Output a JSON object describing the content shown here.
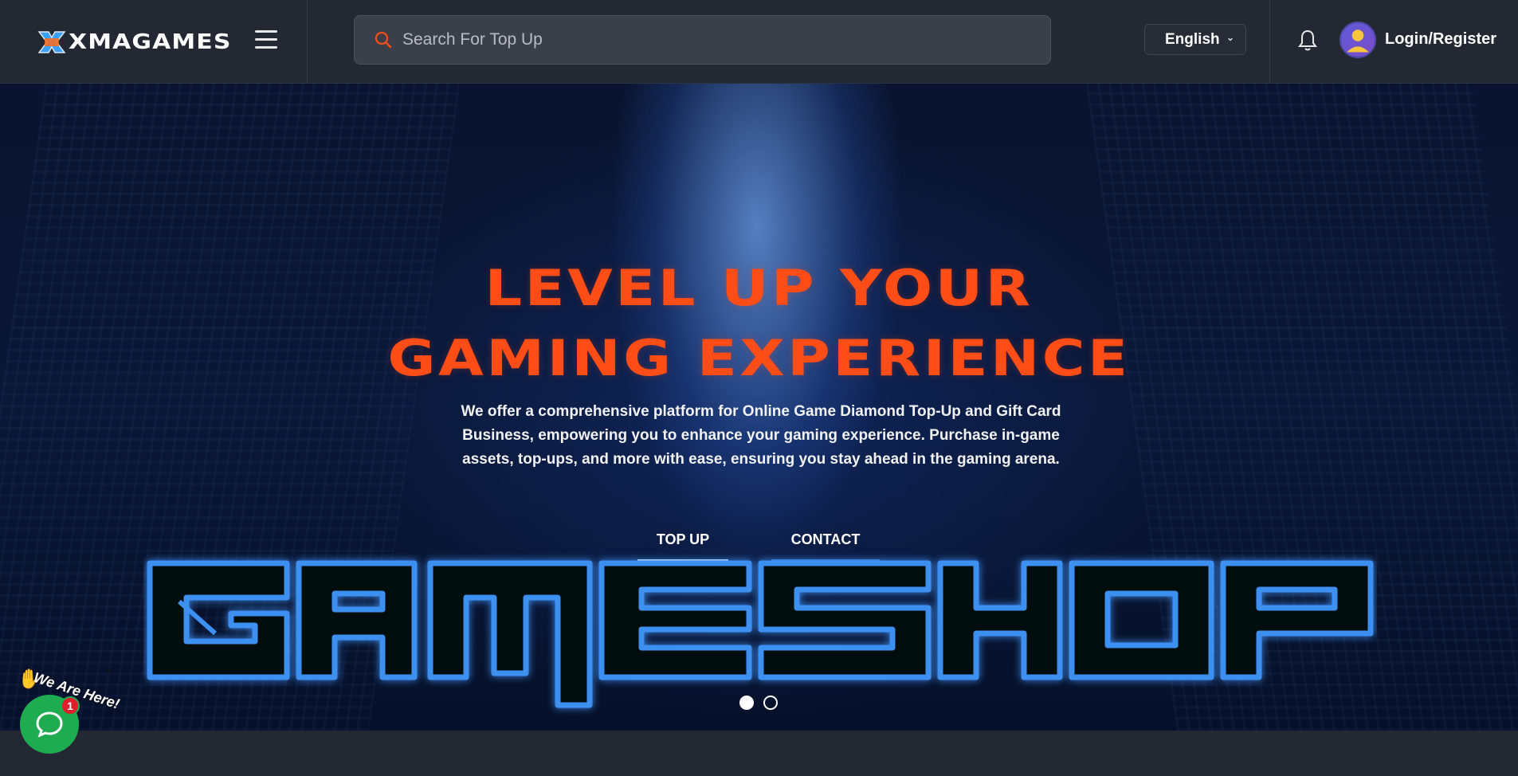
{
  "header": {
    "logo_text": "XMAGAMES",
    "search_placeholder": "Search For Top Up",
    "language": "English",
    "login_label": "Login/Register"
  },
  "hero": {
    "title_line1": "LEVEL UP YOUR",
    "title_line2": "GAMING EXPERIENCE",
    "description": "We offer a comprehensive platform for Online Game Diamond Top-Up and Gift Card Business, empowering you to enhance your gaming experience. Purchase in-game assets, top-ups, and more with ease, ensuring you stay ahead in the gaming arena.",
    "button_topup": "TOP UP",
    "button_contact": "CONTACT",
    "neon_text": "GAMESHOP",
    "slides": [
      {
        "active": true
      },
      {
        "active": false
      }
    ]
  },
  "chat": {
    "label": "We Are Here!",
    "badge_count": "1",
    "close_glyph": "×"
  },
  "colors": {
    "accent_orange": "#ff4d17",
    "neon_blue": "#3d8ff0",
    "chat_green": "#1fab50",
    "header_bg": "#232833"
  }
}
